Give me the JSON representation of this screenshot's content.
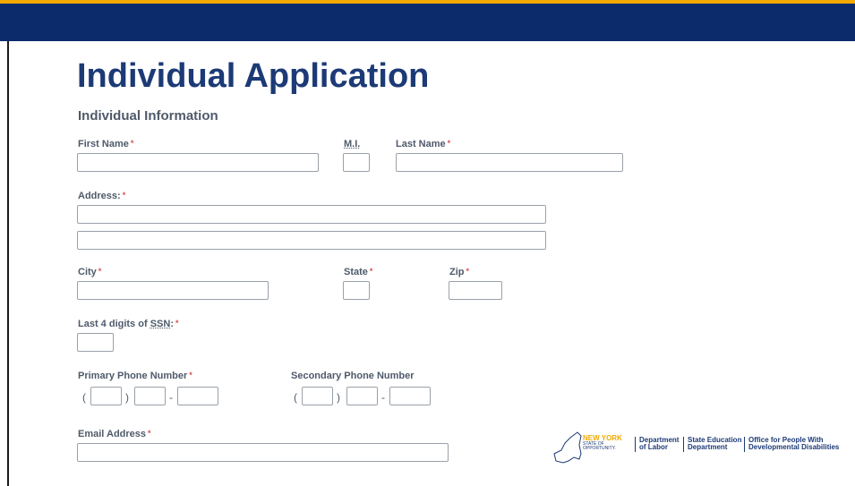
{
  "page": {
    "title": "Individual Application",
    "section_title": "Individual Information"
  },
  "form": {
    "first_name": {
      "label": "First Name",
      "required": "*",
      "value": ""
    },
    "mi": {
      "label": "M.I.",
      "value": ""
    },
    "last_name": {
      "label": "Last Name",
      "required": "*",
      "value": ""
    },
    "address": {
      "label": "Address:",
      "required": "*",
      "line1": "",
      "line2": ""
    },
    "city": {
      "label": "City",
      "required": "*",
      "value": ""
    },
    "state": {
      "label": "State",
      "required": "*",
      "value": ""
    },
    "zip": {
      "label": "Zip",
      "required": "*",
      "value": ""
    },
    "ssn": {
      "label_prefix": "Last 4 digits of ",
      "label_abbr": "SSN",
      "label_suffix": ":",
      "required": "*",
      "value": ""
    },
    "primary_phone": {
      "label": "Primary Phone Number",
      "required": "*",
      "area": "",
      "prefix": "",
      "line": ""
    },
    "secondary_phone": {
      "label": "Secondary Phone Number",
      "area": "",
      "prefix": "",
      "line": ""
    },
    "email": {
      "label": "Email Address",
      "required": "*",
      "value": ""
    },
    "phone_punct": {
      "open": "(",
      "close": ")",
      "dash": "-"
    }
  },
  "footer": {
    "ny_logo": {
      "line1": "NEW YORK",
      "line2": "STATE OF",
      "line3": "OPPORTUNITY."
    },
    "agencies": [
      {
        "line1": "Department",
        "line2": "of Labor"
      },
      {
        "line1": "State Education",
        "line2": "Department"
      },
      {
        "line1": "Office for People With",
        "line2": "Developmental Disabilities"
      }
    ]
  },
  "colors": {
    "header_bar": "#0c2b6b",
    "accent_stripe": "#f2a900",
    "title": "#1c3a76",
    "label": "#4e5a6a",
    "required": "#d9534f"
  }
}
